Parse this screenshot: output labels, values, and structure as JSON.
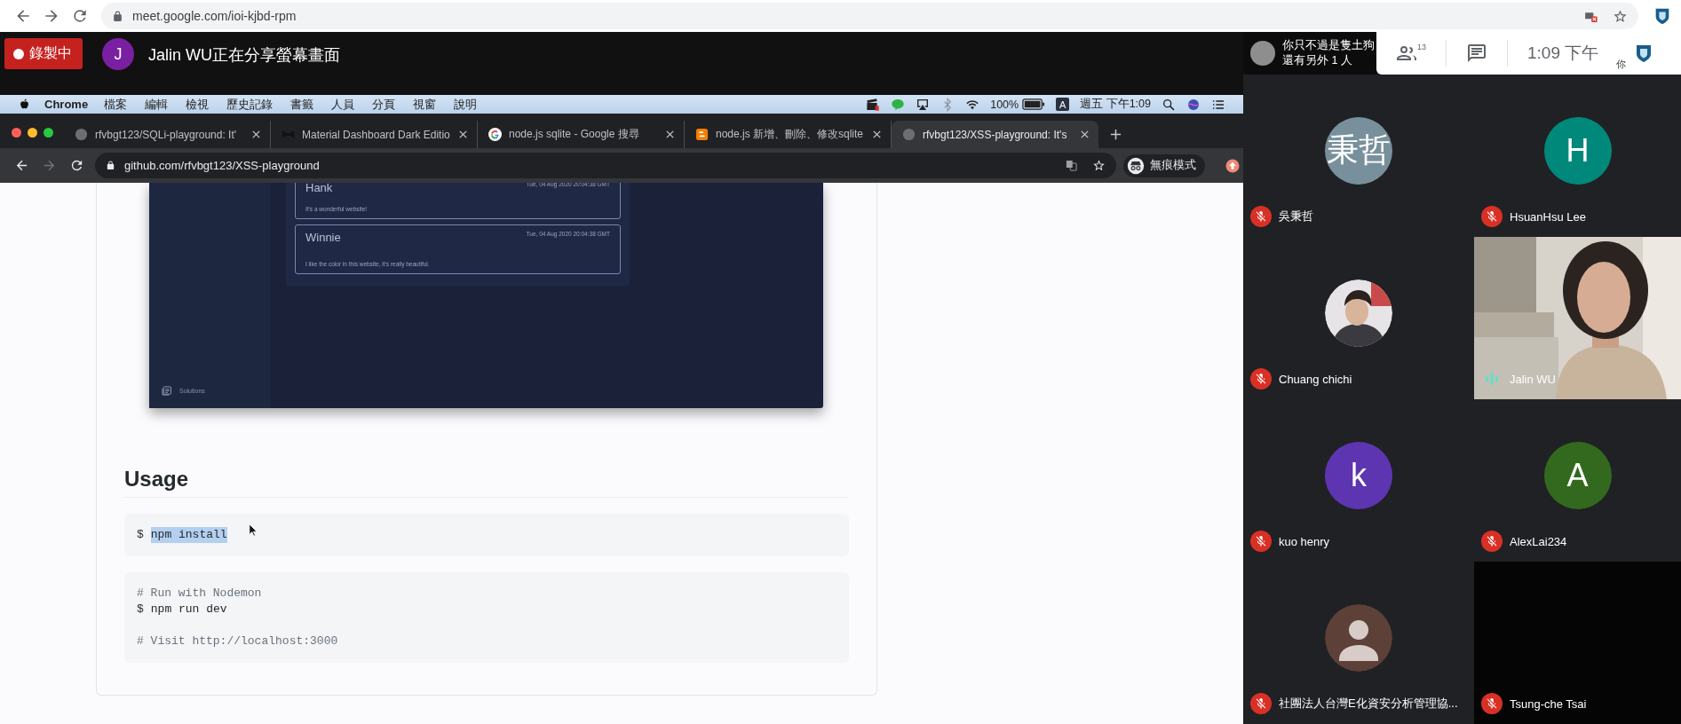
{
  "browser": {
    "url": "meet.google.com/ioi-kjbd-rpm"
  },
  "meeting": {
    "recording_label": "錄製中",
    "presenter_initial": "J",
    "presenting_text": "Jalin WU正在分享螢幕畫面"
  },
  "notification": {
    "lines": [
      "你只不過是隻土狗",
      "還有另外 1 人"
    ]
  },
  "toolbar": {
    "participant_count": "13",
    "time": "1:09 下午",
    "self_label": "你"
  },
  "shared_screen": {
    "menubar": {
      "app": "Chrome",
      "items": [
        "檔案",
        "編輯",
        "檢視",
        "歷史記錄",
        "書籤",
        "人員",
        "分頁",
        "視窗",
        "說明"
      ],
      "battery": "100%",
      "input_method": "A",
      "clock": "週五 下午1:09"
    },
    "tabs": [
      {
        "title": "rfvbgt123/SQLi-playground: It'",
        "kind": "github",
        "selected": false
      },
      {
        "title": "Material Dashboard Dark Editio",
        "kind": "bowtie",
        "selected": false
      },
      {
        "title": "node.js sqlite - Google 搜尋",
        "kind": "google",
        "selected": false
      },
      {
        "title": "node.js 新增、刪除、修改sqlite",
        "kind": "blogger",
        "selected": false
      },
      {
        "title": "rfvbgt123/XSS-playground: It's",
        "kind": "github",
        "selected": true
      }
    ],
    "address": {
      "url": "github.com/rfvbgt123/XSS-playground",
      "profile": "無痕模式"
    },
    "readme": {
      "preview": {
        "comments": [
          {
            "name": "Hank",
            "date": "Tue, 04 Aug 2020 20:04:38 GMT",
            "message": "It's a wonderful website!"
          },
          {
            "name": "Winnie",
            "date": "Tue, 04 Aug 2020 20:04:38 GMT",
            "message": "I like the color in this website, it's really beautiful."
          }
        ],
        "sidebar_item": "Solutions"
      },
      "heading": "Usage",
      "code_blocks": [
        {
          "groups": [
            [
              {
                "kind": "command",
                "prompt": "$",
                "text": "npm install",
                "selected": true
              }
            ]
          ]
        },
        {
          "groups": [
            [
              {
                "kind": "comment",
                "text": "# Run with Nodemon"
              },
              {
                "kind": "command",
                "prompt": "$",
                "text": "npm run dev",
                "selected": false
              }
            ],
            [
              {
                "kind": "comment",
                "text": "# Visit http://localhost:3000"
              }
            ]
          ]
        }
      ]
    }
  },
  "participants": [
    {
      "name": "吳秉哲",
      "kind": "letter",
      "initial": "秉哲",
      "color": "#78909c",
      "muted": true
    },
    {
      "name": "HsuanHsu Lee",
      "kind": "letter",
      "initial": "H",
      "color": "#00897b",
      "muted": true
    },
    {
      "name": "Chuang chichi",
      "muted": true
    },
    {
      "name": "Jalin WU",
      "kind": "video",
      "muted": false
    },
    {
      "name": "kuo henry",
      "kind": "letter",
      "initial": "k",
      "color": "#5e35b1",
      "muted": true
    },
    {
      "name": "AlexLai234",
      "kind": "letter",
      "initial": "A",
      "color": "#33691e",
      "muted": true
    },
    {
      "name": "社團法人台灣E化資安分析管理協...",
      "kind": "silhouette",
      "color": "#5d4037",
      "muted": true
    },
    {
      "name": "Tsung-che Tsai",
      "kind": "dark-video",
      "muted": true
    }
  ]
}
